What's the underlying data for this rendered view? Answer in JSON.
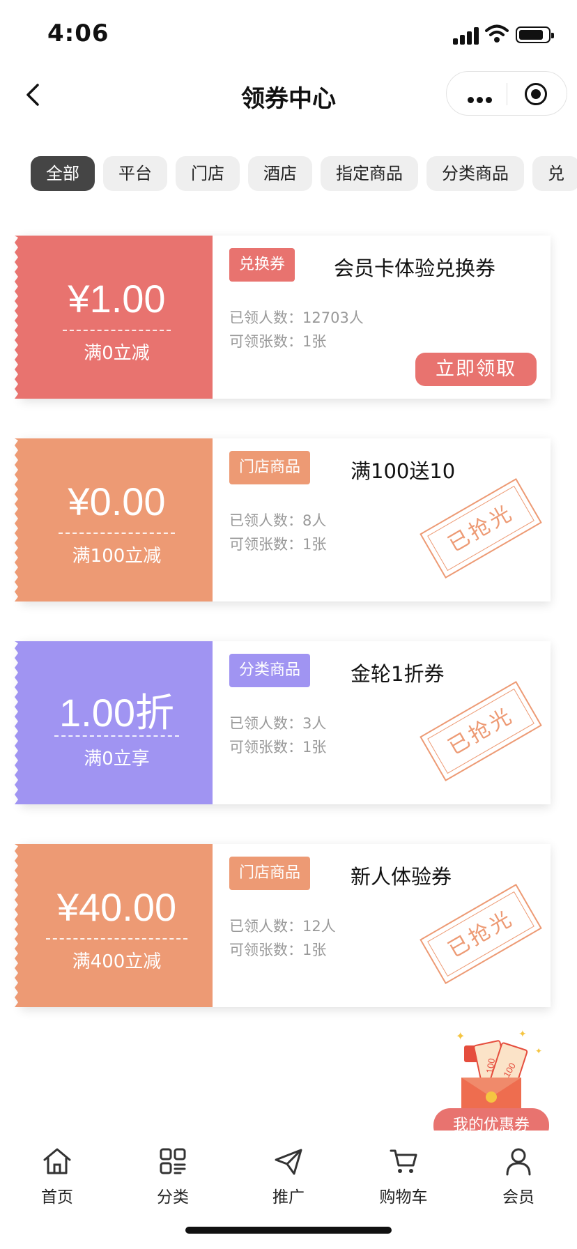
{
  "status_bar": {
    "time": "4:06"
  },
  "navbar": {
    "title": "领券中心"
  },
  "tabs": [
    "全部",
    "平台",
    "门店",
    "酒店",
    "指定商品",
    "分类商品",
    "兑"
  ],
  "coupons": [
    {
      "amount": "¥1.00",
      "condition": "满0立减",
      "tag": "兑换券",
      "name": "会员卡体验兑换券",
      "received": "已领人数：12703人",
      "limit": "可领张数：1张",
      "action": "立即领取",
      "color": "#e8736f",
      "tag_color": "#e8736f"
    },
    {
      "amount": "¥0.00",
      "condition": "满100立减",
      "tag": "门店商品",
      "name": "满100送10",
      "received": "已领人数：8人",
      "limit": "可领张数：1张",
      "stamp": "已抢光",
      "color": "#ed9a74",
      "tag_color": "#ed9a74"
    },
    {
      "amount": "1.00折",
      "condition": "满0立享",
      "tag": "分类商品",
      "name": "金轮1折券",
      "received": "已领人数：3人",
      "limit": "可领张数：1张",
      "stamp": "已抢光",
      "color": "#a094f2",
      "tag_color": "#a094f2"
    },
    {
      "amount": "¥40.00",
      "condition": "满400立减",
      "tag": "门店商品",
      "name": "新人体验券",
      "received": "已领人数：12人",
      "limit": "可领张数：1张",
      "stamp": "已抢光",
      "color": "#ed9a74",
      "tag_color": "#ed9a74"
    }
  ],
  "fab": {
    "label": "我的优惠券",
    "badge": "100"
  },
  "bottom_nav": [
    {
      "label": "首页",
      "icon": "home-icon"
    },
    {
      "label": "分类",
      "icon": "category-icon"
    },
    {
      "label": "推广",
      "icon": "paper-plane-icon"
    },
    {
      "label": "购物车",
      "icon": "cart-icon"
    },
    {
      "label": "会员",
      "icon": "user-icon"
    }
  ]
}
